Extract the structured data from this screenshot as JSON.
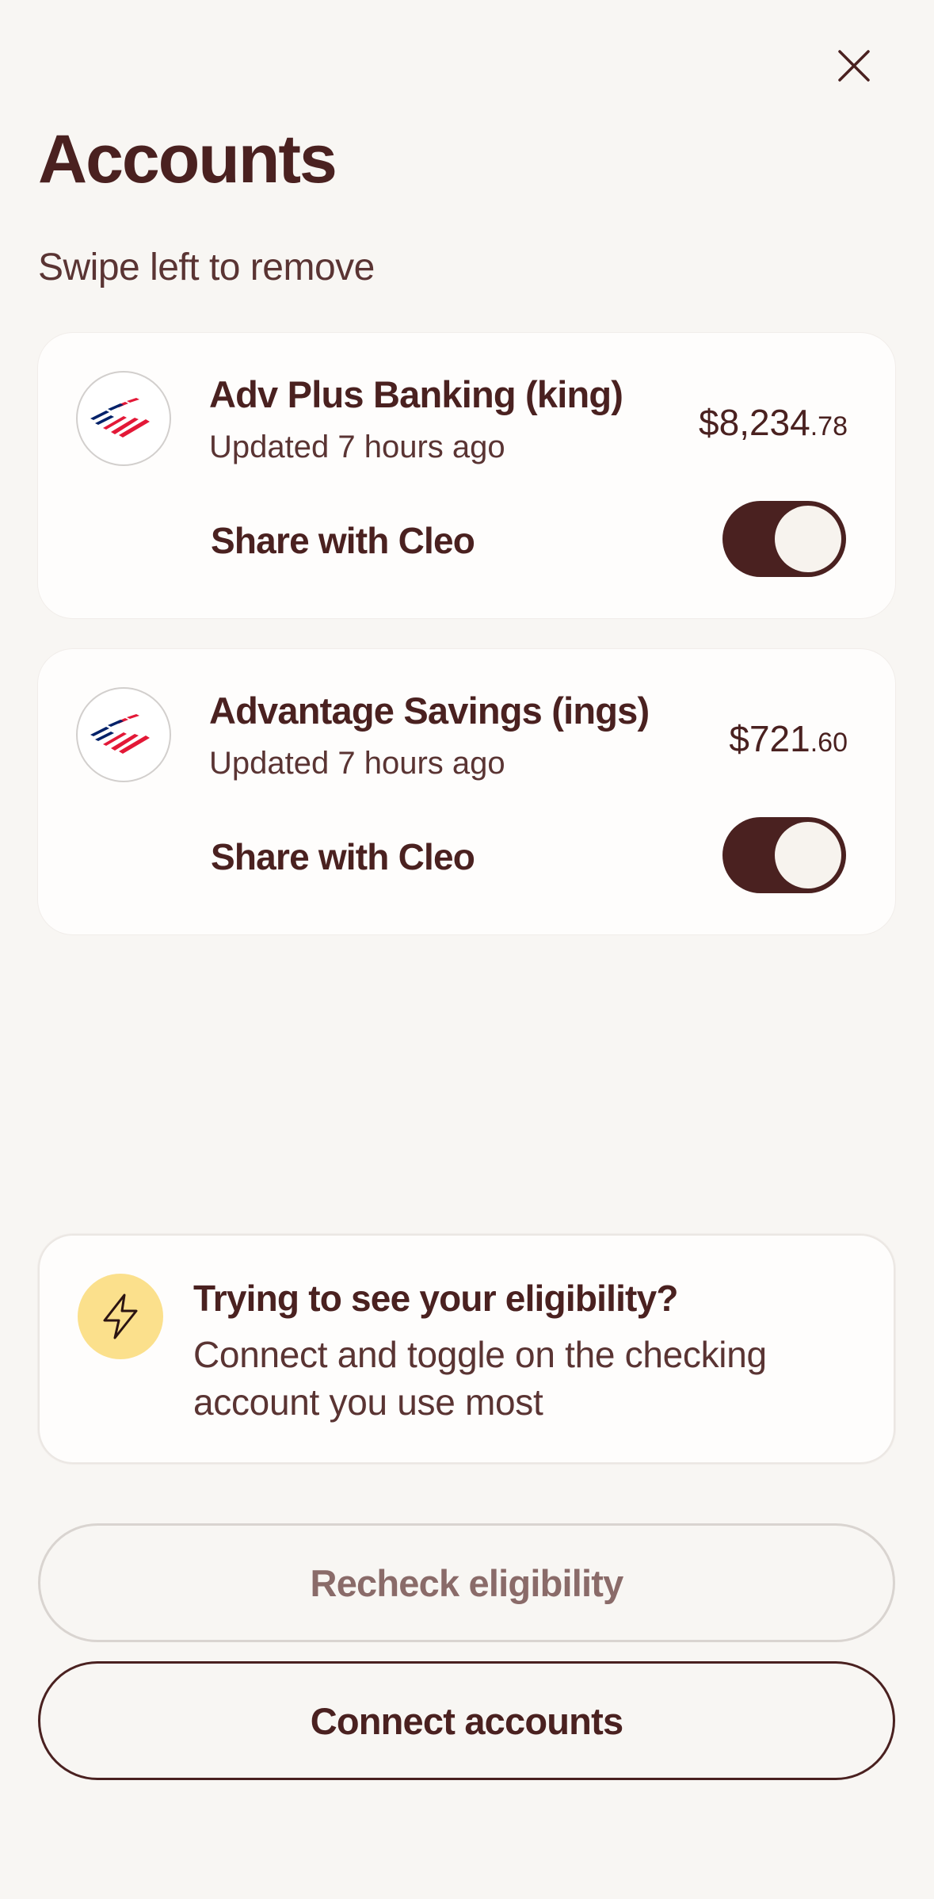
{
  "header": {
    "title": "Accounts",
    "subtitle": "Swipe left to remove",
    "close_icon": "close-icon"
  },
  "accounts": [
    {
      "name": "Adv Plus Banking (king)",
      "updated": "Updated 7 hours ago",
      "balance_main": "$8,234",
      "balance_cents": ".78",
      "share_label": "Share with Cleo",
      "share_enabled": true,
      "logo_icon": "bank-of-america-logo"
    },
    {
      "name": "Advantage Savings (ings)",
      "updated": "Updated 7 hours ago",
      "balance_main": "$721",
      "balance_cents": ".60",
      "share_label": "Share with Cleo",
      "share_enabled": true,
      "logo_icon": "bank-of-america-logo"
    }
  ],
  "eligibility": {
    "icon": "lightning-bolt-icon",
    "title": "Trying to see your eligibility?",
    "body": "Connect and toggle on the checking account you use most"
  },
  "buttons": {
    "recheck": "Recheck eligibility",
    "connect": "Connect accounts"
  },
  "colors": {
    "background": "#f8f6f3",
    "card": "#fefdfc",
    "primary_text": "#4a2120",
    "toggle_on": "#4a2120",
    "bolt_bg": "#fbe08c",
    "logo_red": "#e31837",
    "logo_navy": "#012169"
  }
}
